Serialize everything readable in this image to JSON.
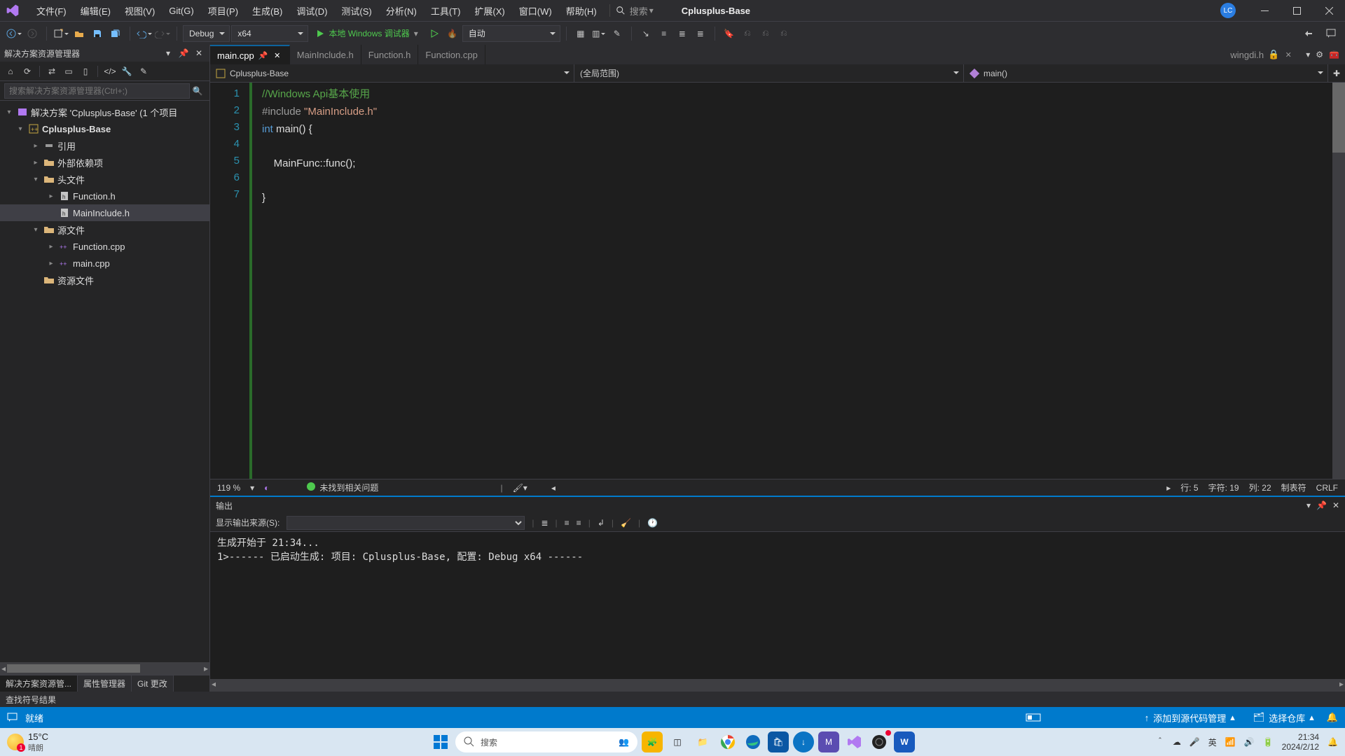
{
  "menu": {
    "file": "文件(F)",
    "edit": "编辑(E)",
    "view": "视图(V)",
    "git": "Git(G)",
    "project": "项目(P)",
    "build": "生成(B)",
    "debug": "调试(D)",
    "test": "测试(S)",
    "analyze": "分析(N)",
    "tools": "工具(T)",
    "extensions": "扩展(X)",
    "window": "窗口(W)",
    "help": "帮助(H)",
    "search": "搜索"
  },
  "solutionName": "Cplusplus-Base",
  "userInitials": "LC",
  "toolbar": {
    "config": "Debug",
    "platform": "x64",
    "debugTarget": "本地 Windows 调试器",
    "auto": "自动"
  },
  "explorer": {
    "title": "解决方案资源管理器",
    "searchPlaceholder": "搜索解决方案资源管理器(Ctrl+;)",
    "solutionLine": "解决方案 'Cplusplus-Base' (1 个项目",
    "project": "Cplusplus-Base",
    "refs": "引用",
    "external": "外部依赖项",
    "headers": "头文件",
    "headerFiles": [
      "Function.h",
      "MainInclude.h"
    ],
    "sources": "源文件",
    "sourceFiles": [
      "Function.cpp",
      "main.cpp"
    ],
    "resources": "资源文件",
    "bottomTabs": {
      "sol": "解决方案资源管...",
      "prop": "属性管理器",
      "git": "Git 更改"
    }
  },
  "tabs": {
    "main": "main.cpp",
    "t1": "MainInclude.h",
    "t2": "Function.h",
    "t3": "Function.cpp",
    "right": "wingdi.h"
  },
  "navBar": {
    "project": "Cplusplus-Base",
    "scope": "(全局范围)",
    "member": "main()"
  },
  "code": {
    "lines": [
      "1",
      "2",
      "3",
      "4",
      "5",
      "6",
      "7"
    ],
    "l1_comment": "//Windows Api基本使用",
    "l2_a": "#include ",
    "l2_b": "\"MainInclude.h\"",
    "l3_a": "int",
    "l3_b": " main() {",
    "l5": "    MainFunc::func();",
    "l7": "}"
  },
  "editorStatus": {
    "zoom": "119 %",
    "issues": "未找到相关问题",
    "line": "行: 5",
    "char": "字符: 19",
    "col": "列: 22",
    "tabs": "制表符",
    "enc": "CRLF"
  },
  "output": {
    "title": "输出",
    "sourceLabel": "显示输出来源(S):",
    "body": "生成开始于 21:34...\n1>------ 已启动生成: 项目: Cplusplus-Base, 配置: Debug x64 ------\n"
  },
  "symbolBar": "查找符号结果",
  "statusBar": {
    "ready": "就绪",
    "addSrc": "添加到源代码管理",
    "selectRepo": "选择仓库"
  },
  "taskbar": {
    "temp": "15°C",
    "tempDesc": "晴朗",
    "search": "搜索",
    "ime": "英",
    "time": "21:34",
    "date": "2024/2/12"
  }
}
